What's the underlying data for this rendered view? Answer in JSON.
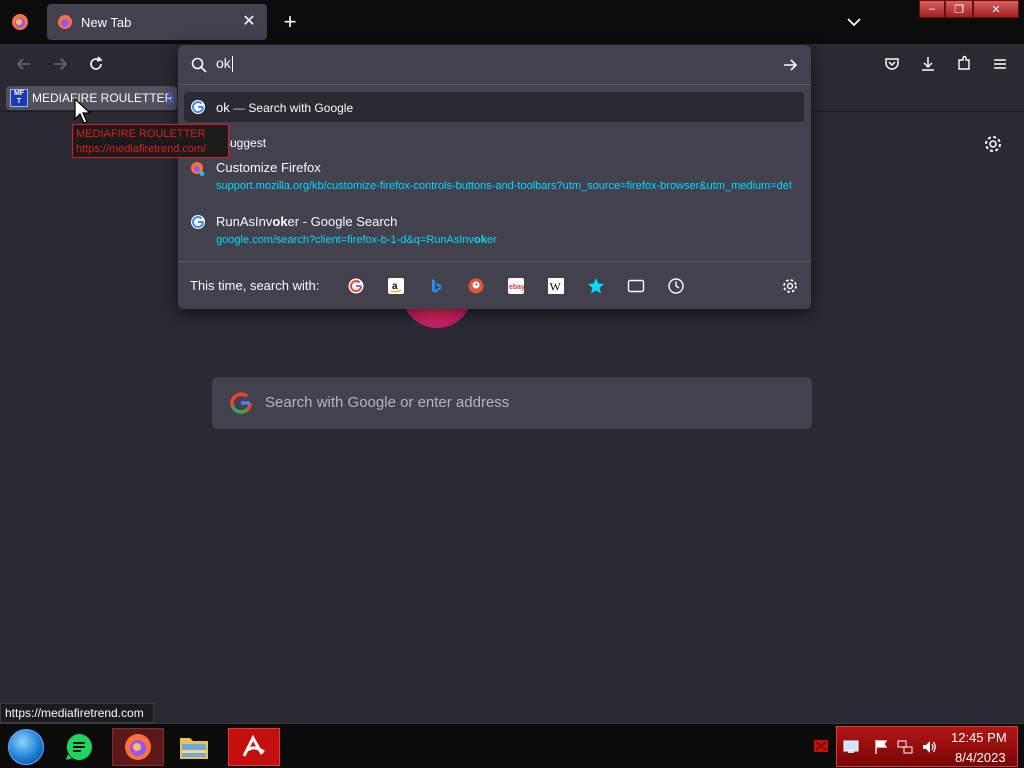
{
  "browser": {
    "tab": {
      "title": "New Tab",
      "close_glyph": "✕"
    },
    "newtab_glyph": "+",
    "window_controls": [
      "–",
      "❐",
      "✕"
    ]
  },
  "bookmarks": {
    "item_label": "MEDIAFIRE ROULETTER",
    "favicon_text": "MF T"
  },
  "tooltip": {
    "title": "MEDIAFIRE ROULETTER",
    "url": "https://mediafiretrend.com/"
  },
  "urlbar": {
    "value": "ok",
    "heuristic": {
      "query": "ok",
      "separator": " — ",
      "action": "Search with Google"
    },
    "group_label": "Suggest",
    "results": [
      {
        "title": "Customize Firefox",
        "url": "support.mozilla.org/kb/customize-firefox-controls-buttons-and-toolbars?utm_source=firefox-browser&utm_medium=default-bookmarks&utm_campaign=customize"
      },
      {
        "title_pre": "RunAsInv",
        "title_bold": "ok",
        "title_post": "er - Google Search",
        "url_pre": "google.com/search?client=firefox-b-1-d&q=RunAsInv",
        "url_bold": "ok",
        "url_post": "er"
      }
    ],
    "oneoff_label": "This time, search with:",
    "oneoff_engines": [
      "google-icon",
      "amazon-icon",
      "bing-icon",
      "duckduckgo-icon",
      "ebay-icon",
      "wikipedia-icon",
      "bookmarks-icon",
      "tabs-icon",
      "history-icon"
    ]
  },
  "page": {
    "search_placeholder": "Search with Google or enter address"
  },
  "status": {
    "url": "https://mediafiretrend.com"
  },
  "tray": {
    "time": "12:45 PM",
    "date": "8/4/2023"
  },
  "colors": {
    "accent_url": "#00ddff",
    "tooltip_red": "#e21d1d",
    "tray_red": "#b11616"
  }
}
